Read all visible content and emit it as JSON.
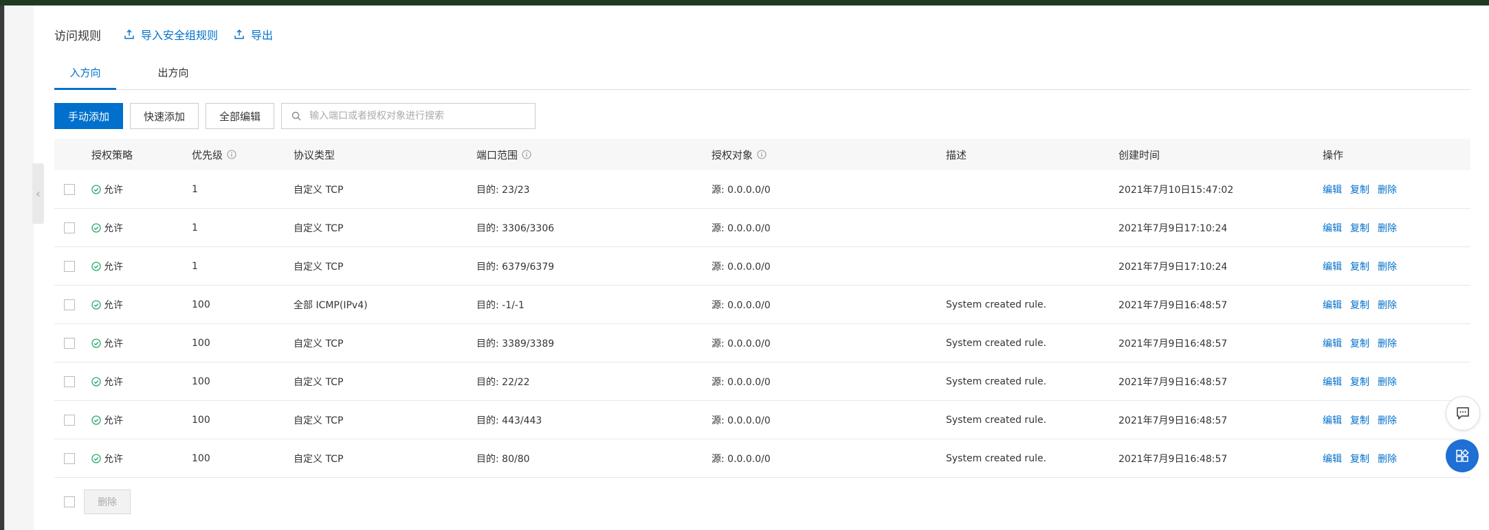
{
  "header": {
    "title": "访问规则",
    "import_label": "导入安全组规则",
    "export_label": "导出"
  },
  "tabs": [
    {
      "label": "入方向",
      "active": true
    },
    {
      "label": "出方向",
      "active": false
    }
  ],
  "toolbar": {
    "manual_add": "手动添加",
    "quick_add": "快速添加",
    "edit_all": "全部编辑",
    "search_placeholder": "输入端口或者授权对象进行搜索"
  },
  "table": {
    "columns": [
      "授权策略",
      "优先级",
      "协议类型",
      "端口范围",
      "授权对象",
      "描述",
      "创建时间",
      "操作"
    ],
    "ops": [
      "编辑",
      "复制",
      "删除"
    ],
    "rows": [
      {
        "policy": "允许",
        "priority": "1",
        "protocol": "自定义 TCP",
        "port": "目的: 23/23",
        "object": "源: 0.0.0.0/0",
        "desc": "",
        "time": "2021年7月10日15:47:02"
      },
      {
        "policy": "允许",
        "priority": "1",
        "protocol": "自定义 TCP",
        "port": "目的: 3306/3306",
        "object": "源: 0.0.0.0/0",
        "desc": "",
        "time": "2021年7月9日17:10:24"
      },
      {
        "policy": "允许",
        "priority": "1",
        "protocol": "自定义 TCP",
        "port": "目的: 6379/6379",
        "object": "源: 0.0.0.0/0",
        "desc": "",
        "time": "2021年7月9日17:10:24"
      },
      {
        "policy": "允许",
        "priority": "100",
        "protocol": "全部 ICMP(IPv4)",
        "port": "目的: -1/-1",
        "object": "源: 0.0.0.0/0",
        "desc": "System created rule.",
        "time": "2021年7月9日16:48:57"
      },
      {
        "policy": "允许",
        "priority": "100",
        "protocol": "自定义 TCP",
        "port": "目的: 3389/3389",
        "object": "源: 0.0.0.0/0",
        "desc": "System created rule.",
        "time": "2021年7月9日16:48:57"
      },
      {
        "policy": "允许",
        "priority": "100",
        "protocol": "自定义 TCP",
        "port": "目的: 22/22",
        "object": "源: 0.0.0.0/0",
        "desc": "System created rule.",
        "time": "2021年7月9日16:48:57"
      },
      {
        "policy": "允许",
        "priority": "100",
        "protocol": "自定义 TCP",
        "port": "目的: 443/443",
        "object": "源: 0.0.0.0/0",
        "desc": "System created rule.",
        "time": "2021年7月9日16:48:57"
      },
      {
        "policy": "允许",
        "priority": "100",
        "protocol": "自定义 TCP",
        "port": "目的: 80/80",
        "object": "源: 0.0.0.0/0",
        "desc": "System created rule.",
        "time": "2021年7月9日16:48:57"
      }
    ]
  },
  "footer": {
    "delete_label": "删除"
  },
  "colors": {
    "accent": "#0070cc",
    "allow_green": "#2aa76a",
    "float_blue": "#1f6fd4"
  }
}
